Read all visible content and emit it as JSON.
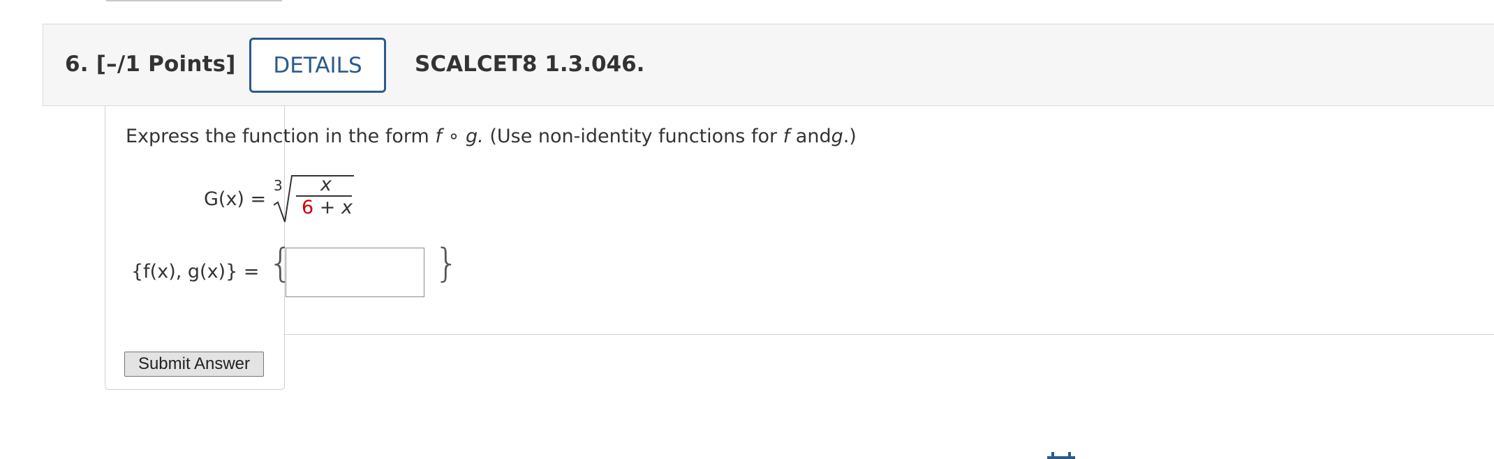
{
  "question": {
    "number": "6.",
    "points": "[–/1 Points]",
    "details_label": "DETAILS",
    "code": "SCALCET8 1.3.046."
  },
  "prompt": {
    "lead": "Express the function in the form",
    "f": "f",
    "compose": "∘",
    "g": "g.",
    "paren_open": "(Use non-identity functions for",
    "f2": "f",
    "and": "and",
    "g2": "g",
    "paren_close": ".)"
  },
  "formula": {
    "lhs": "G(x) =",
    "root_index": "3",
    "numerator": "x",
    "denominator_constant": "6",
    "denominator_rest": " + ",
    "denominator_var": "x"
  },
  "answer": {
    "label": "{f(x), g(x)} =",
    "left_brace": "{",
    "right_brace": "}",
    "value": "",
    "placeholder": ""
  },
  "actions": {
    "submit_label": "Submit Answer"
  },
  "colors": {
    "accent": "#2a5a8f",
    "highlight": "#cc0000",
    "header_bg": "#f6f6f6"
  },
  "icons": {
    "partial_bottom": "calendar-icon"
  }
}
